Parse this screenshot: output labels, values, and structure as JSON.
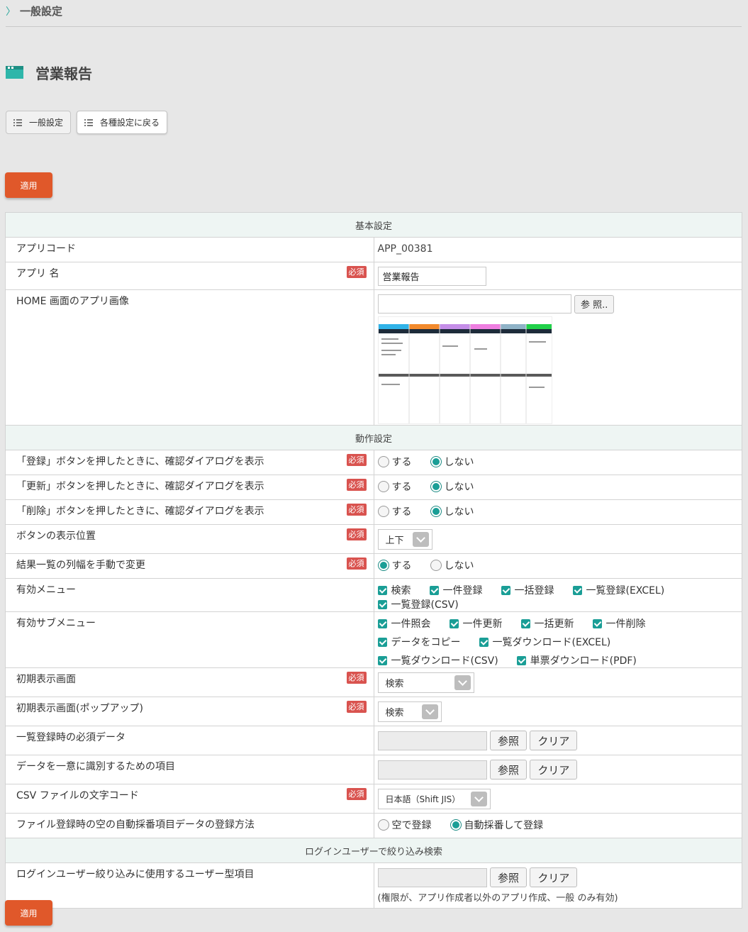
{
  "breadcrumb": {
    "label": "一般設定"
  },
  "page": {
    "title": "営業報告"
  },
  "nav": {
    "general_label": "一般設定",
    "back_label": "各種設定に戻る"
  },
  "apply_label": "適用",
  "required_label": "必須",
  "sections": {
    "basic": "基本設定",
    "behavior": "動作設定",
    "login_filter": "ログインユーザーで絞り込み検索"
  },
  "fields": {
    "app_code": {
      "label": "アプリコード",
      "value": "APP_00381"
    },
    "app_name": {
      "label": "アプリ 名",
      "value": "営業報告"
    },
    "home_image": {
      "label": "HOME 画面のアプリ画像",
      "browse_label": "参 照.."
    },
    "confirm_register": {
      "label": "「登録」ボタンを押したときに、確認ダイアログを表示",
      "options": [
        "する",
        "しない"
      ],
      "selected": "しない"
    },
    "confirm_update": {
      "label": "「更新」ボタンを押したときに、確認ダイアログを表示",
      "options": [
        "する",
        "しない"
      ],
      "selected": "しない"
    },
    "confirm_delete": {
      "label": "「削除」ボタンを押したときに、確認ダイアログを表示",
      "options": [
        "する",
        "しない"
      ],
      "selected": "しない"
    },
    "button_position": {
      "label": "ボタンの表示位置",
      "value": "上下"
    },
    "column_width": {
      "label": "結果一覧の列幅を手動で変更",
      "options": [
        "する",
        "しない"
      ],
      "selected": "する"
    },
    "menus": {
      "label": "有効メニュー",
      "items": [
        "検索",
        "一件登録",
        "一括登録",
        "一覧登録(EXCEL)",
        "一覧登録(CSV)"
      ]
    },
    "submenus": {
      "label": "有効サブメニュー",
      "items": [
        "一件照会",
        "一件更新",
        "一括更新",
        "一件削除",
        "データをコピー",
        "一覧ダウンロード(EXCEL)",
        "一覧ダウンロード(CSV)",
        "単票ダウンロード(PDF)"
      ]
    },
    "initial_screen": {
      "label": "初期表示画面",
      "value": "検索"
    },
    "initial_popup": {
      "label": "初期表示画面(ポップアップ)",
      "value": "検索"
    },
    "required_data": {
      "label": "一覧登録時の必須データ"
    },
    "unique_key": {
      "label": "データを一意に識別するための項目"
    },
    "csv_encoding": {
      "label": "CSV ファイルの文字コード",
      "value": "日本語（Shift JIS）"
    },
    "auto_number": {
      "label": "ファイル登録時の空の自動採番項目データの登録方法",
      "options": [
        "空で登録",
        "自動採番して登録"
      ],
      "selected": "自動採番して登録"
    },
    "login_user_field": {
      "label": "ログインユーザー絞り込みに使用するユーザー型項目",
      "note": "(権限が、アプリ作成者以外のアプリ作成、一般 のみ有効)"
    }
  },
  "ref_label": "参照",
  "clear_label": "クリア",
  "colors": {
    "accent": "#1a9e96",
    "apply": "#e0582a",
    "required": "#d9534f",
    "section_bg": "#eef5f3"
  }
}
